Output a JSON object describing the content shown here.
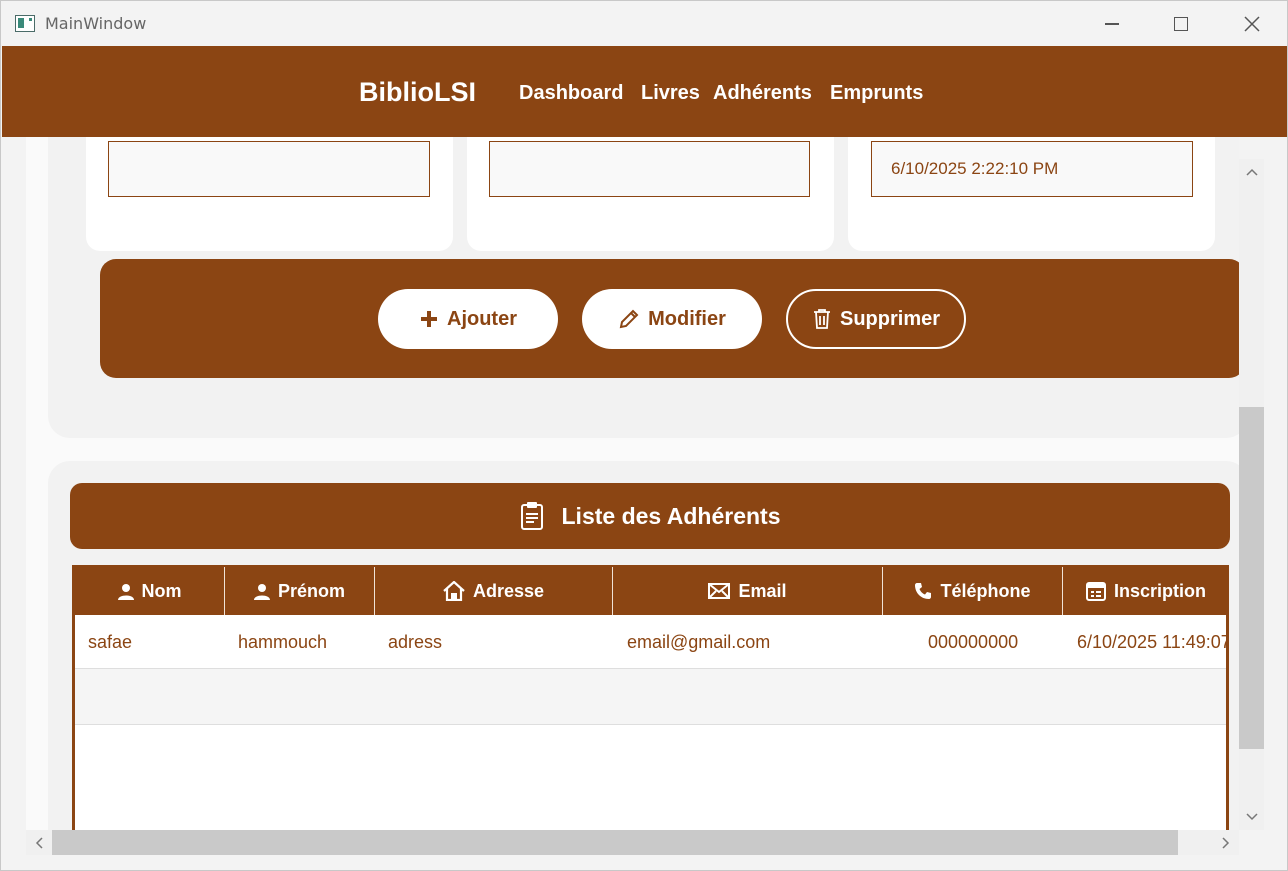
{
  "window": {
    "title": "MainWindow"
  },
  "navbar": {
    "brand": "BiblioLSI",
    "links": [
      "Dashboard",
      "Livres",
      "Adhérents",
      "Emprunts"
    ]
  },
  "form": {
    "fields": [
      {
        "value": ""
      },
      {
        "value": ""
      },
      {
        "value": "6/10/2025 2:22:10 PM"
      }
    ]
  },
  "actions": {
    "add_label": "Ajouter",
    "edit_label": "Modifier",
    "delete_label": "Supprimer"
  },
  "list": {
    "title": "Liste des Adhérents",
    "columns": [
      {
        "label": "Nom",
        "icon": "user-icon"
      },
      {
        "label": "Prénom",
        "icon": "user-icon"
      },
      {
        "label": "Adresse",
        "icon": "home-icon"
      },
      {
        "label": "Email",
        "icon": "envelope-icon"
      },
      {
        "label": "Téléphone",
        "icon": "phone-icon"
      },
      {
        "label": "Inscription",
        "icon": "calendar-icon"
      }
    ],
    "rows": [
      [
        "safae",
        "hammouch",
        "adress",
        "email@gmail.com",
        "000000000",
        "6/10/2025 11:49:07"
      ]
    ]
  },
  "colors": {
    "accent": "#8b4513",
    "panel": "#f2f2f2",
    "text_on_accent": "#ffffff"
  }
}
